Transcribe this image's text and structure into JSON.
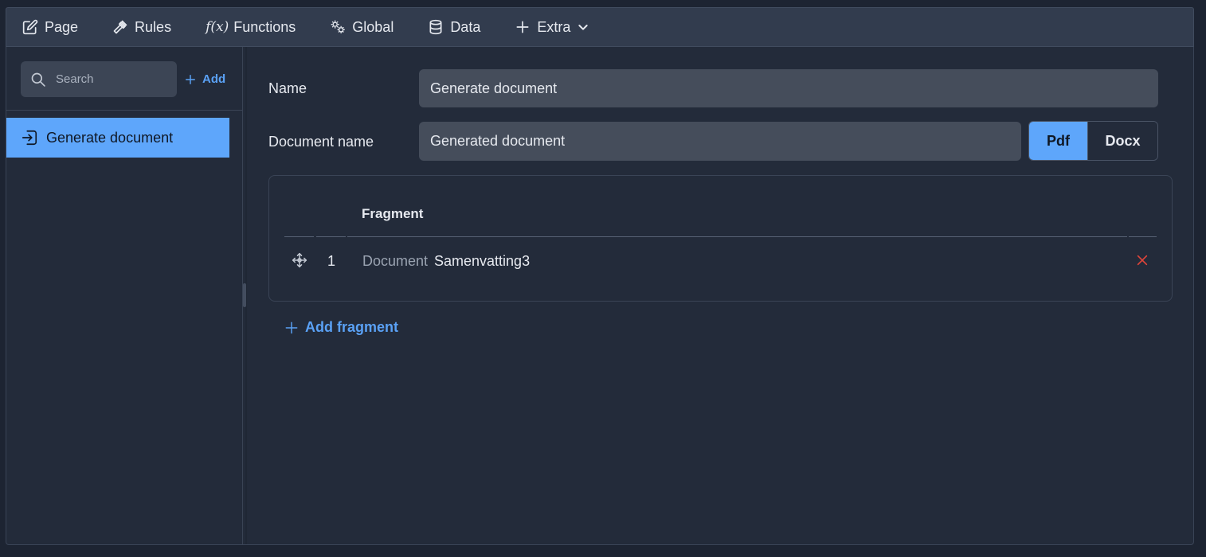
{
  "toolbar": {
    "tabs": [
      {
        "label": "Page",
        "icon": "edit-icon"
      },
      {
        "label": "Rules",
        "icon": "gavel-icon"
      },
      {
        "label": "Functions",
        "icon": "function-icon"
      },
      {
        "label": "Global",
        "icon": "gears-icon"
      },
      {
        "label": "Data",
        "icon": "database-icon"
      },
      {
        "label": "Extra",
        "icon": "plus-icon"
      }
    ]
  },
  "sidebar": {
    "search_placeholder": "Search",
    "add_label": "Add",
    "items": [
      {
        "label": "Generate document",
        "icon": "sign-in-icon",
        "selected": true
      }
    ]
  },
  "form": {
    "name_label": "Name",
    "name_value": "Generate document",
    "docname_label": "Document name",
    "docname_value": "Generated document",
    "formats": [
      "Pdf",
      "Docx"
    ],
    "selected_format": "Pdf"
  },
  "fragments": {
    "header": "Fragment",
    "rows": [
      {
        "index": "1",
        "type": "Document",
        "name": "Samenvatting3"
      }
    ],
    "add_label": "Add fragment"
  },
  "colors": {
    "accent": "#5ea6fb",
    "link": "#5aa1f5",
    "danger": "#e0453a",
    "background": "#1d2432"
  }
}
